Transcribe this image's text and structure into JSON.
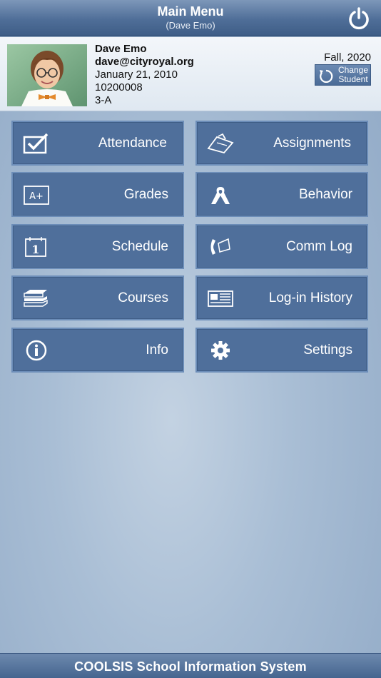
{
  "header": {
    "title": "Main Menu",
    "subtitle": "(Dave Emo)"
  },
  "profile": {
    "name": "Dave Emo",
    "email": "dave@cityroyal.org",
    "birthdate": "January 21, 2010",
    "student_id": "10200008",
    "class": "3-A",
    "term": "Fall, 2020",
    "change_student_line1": "Change",
    "change_student_line2": "Student"
  },
  "menu": {
    "attendance": "Attendance",
    "assignments": "Assignments",
    "grades": "Grades",
    "behavior": "Behavior",
    "schedule": "Schedule",
    "comm_log": "Comm Log",
    "courses": "Courses",
    "login_history": "Log-in History",
    "info": "Info",
    "settings": "Settings"
  },
  "icons": {
    "grades_icon_text": "A+",
    "schedule_icon_text": "1"
  },
  "footer": {
    "text": "COOLSIS  School Information System"
  },
  "colors": {
    "header": "#4f6e98",
    "tile": "#4f6f9b",
    "tile_border": "#6c8db8",
    "background": "#a9bed5"
  }
}
